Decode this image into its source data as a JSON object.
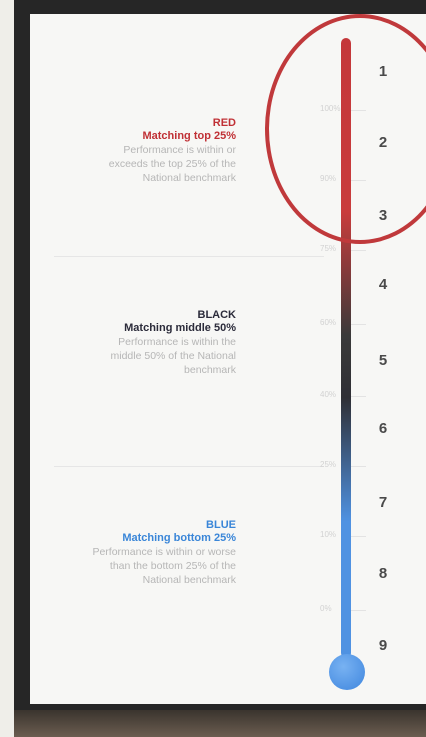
{
  "legend": {
    "red": {
      "name": "RED",
      "subtitle": "Matching top 25%",
      "description_lines": [
        "Performance is within or",
        "exceeds the top 25% of the",
        "National benchmark"
      ],
      "color": "#c03035"
    },
    "black": {
      "name": "BLACK",
      "subtitle": "Matching middle 50%",
      "description_lines": [
        "Performance is within the",
        "middle 50% of the National",
        "benchmark"
      ],
      "color": "#2b2b3a"
    },
    "blue": {
      "name": "BLUE",
      "subtitle": "Matching bottom 25%",
      "description_lines": [
        "Performance is within or worse",
        "than the bottom 25% of the",
        "National benchmark"
      ],
      "color": "#3a86d8"
    }
  },
  "scale_ticks": [
    "100%",
    "90%",
    "75%",
    "60%",
    "40%",
    "25%",
    "10%",
    "0%"
  ],
  "ranks": [
    "1",
    "2",
    "3",
    "4",
    "5",
    "6",
    "7",
    "8",
    "9"
  ],
  "colors": {
    "red": "#c4373a",
    "black": "#2f2f35",
    "blue": "#4f92e2",
    "highlight_circle": "#c0393b"
  }
}
